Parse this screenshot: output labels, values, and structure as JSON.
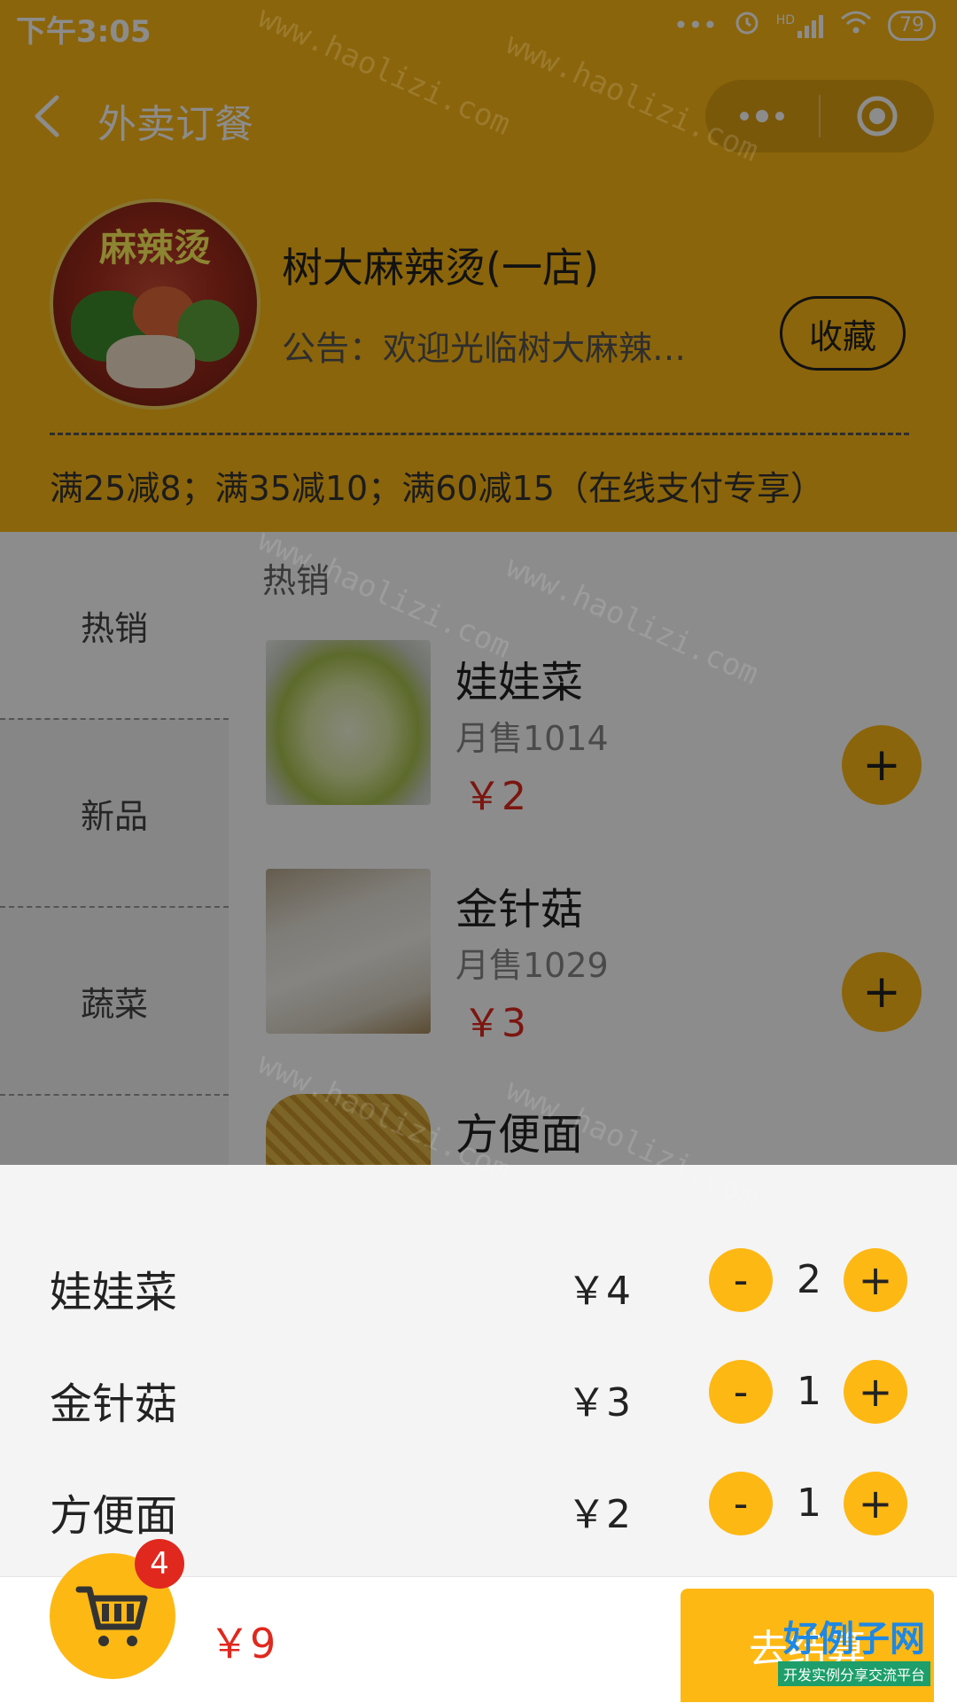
{
  "status_bar": {
    "time": "下午3:05",
    "icons": [
      "more-dots-icon",
      "alarm-icon",
      "signal-icon",
      "wifi-icon"
    ],
    "signal_label": "HD",
    "battery": "79"
  },
  "nav": {
    "title": "外卖订餐",
    "back_icon": "chevron-left-icon",
    "menu_icon": "more-dots-icon",
    "close_icon": "target-circle-icon"
  },
  "shop": {
    "logo_text": "麻辣烫",
    "name": "树大麻辣烫(一店)",
    "notice": "公告：欢迎光临树大麻辣…",
    "favorite_label": "收藏",
    "promotion": "满25减8；满35减10；满60减15（在线支付专享）"
  },
  "categories": [
    {
      "label": "热销",
      "active": true
    },
    {
      "label": "新品",
      "active": false
    },
    {
      "label": "蔬菜",
      "active": false
    }
  ],
  "menu": {
    "section_title": "热销",
    "items": [
      {
        "name": "娃娃菜",
        "sales": "月售1014",
        "price": "￥2",
        "add_label": "+"
      },
      {
        "name": "金针菇",
        "sales": "月售1029",
        "price": "￥3",
        "add_label": "+"
      },
      {
        "name": "方便面"
      }
    ]
  },
  "cart": {
    "items": [
      {
        "name": "娃娃菜",
        "price": "￥4",
        "qty": "2",
        "minus_label": "-",
        "plus_label": "+"
      },
      {
        "name": "金针菇",
        "price": "￥3",
        "qty": "1",
        "minus_label": "-",
        "plus_label": "+"
      },
      {
        "name": "方便面",
        "price": "￥2",
        "qty": "1",
        "minus_label": "-",
        "plus_label": "+"
      }
    ],
    "badge_count": "4",
    "total": "￥9",
    "checkout_label": "去结算"
  },
  "watermark": {
    "text": "www.haolizi.com",
    "brand": "好例子网",
    "brand_sub": "开发实例分享交流平台"
  },
  "colors": {
    "primary": "#fdb814",
    "price": "#e0281e",
    "badge": "#e0281e"
  }
}
